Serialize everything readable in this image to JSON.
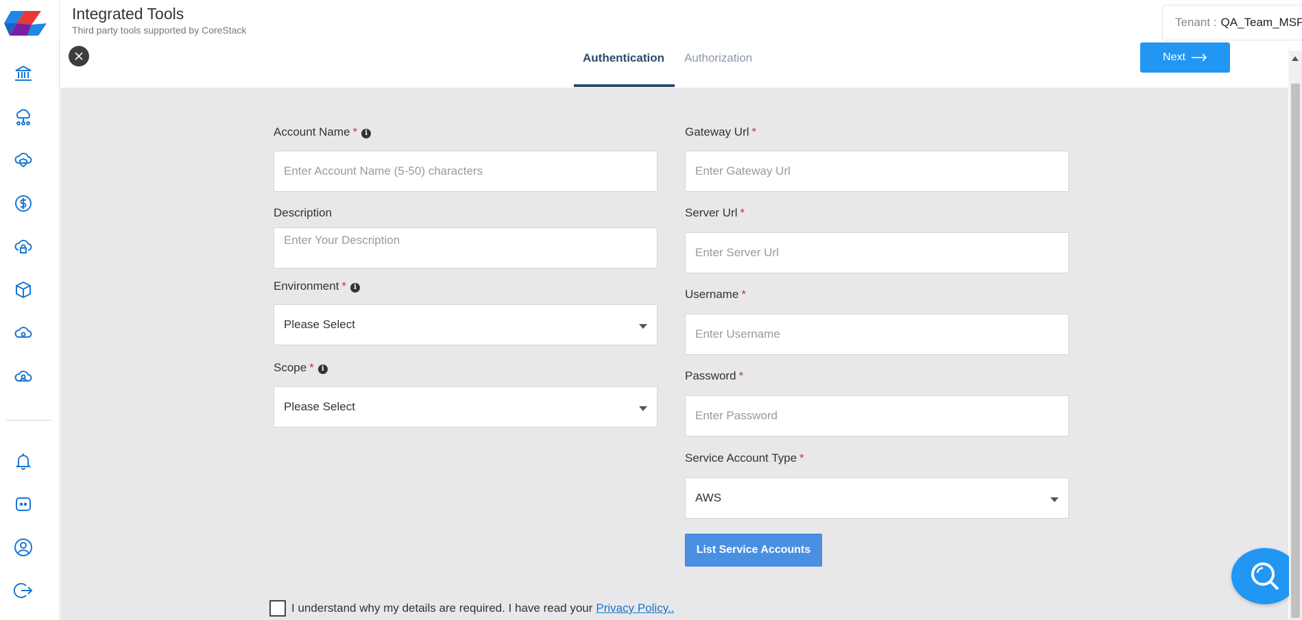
{
  "header": {
    "title": "Integrated Tools",
    "subtitle": "Third party tools supported by CoreStack",
    "tenant_label": "Tenant :",
    "tenant_value": "QA_Team_MSP"
  },
  "sidebar": {
    "items": [
      {
        "icon": "bank-icon"
      },
      {
        "icon": "cloud-network-icon"
      },
      {
        "icon": "cloud-shield-icon"
      },
      {
        "icon": "dollar-icon"
      },
      {
        "icon": "cloud-lock-icon"
      },
      {
        "icon": "cube-icon"
      },
      {
        "icon": "cloud-gear-icon"
      },
      {
        "icon": "cloud-user-icon"
      }
    ],
    "bottom_items": [
      {
        "icon": "bell-icon"
      },
      {
        "icon": "chat-icon"
      },
      {
        "icon": "user-icon"
      },
      {
        "icon": "logout-icon"
      }
    ]
  },
  "tabs": {
    "authentication": "Authentication",
    "authorization": "Authorization",
    "next_label": "Next"
  },
  "form": {
    "account_name": {
      "label": "Account Name",
      "placeholder": "Enter Account Name (5-50) characters"
    },
    "description": {
      "label": "Description",
      "placeholder": "Enter Your Description"
    },
    "environment": {
      "label": "Environment",
      "value": "Please Select"
    },
    "scope": {
      "label": "Scope",
      "value": "Please Select"
    },
    "gateway_url": {
      "label": "Gateway Url",
      "placeholder": "Enter Gateway Url"
    },
    "server_url": {
      "label": "Server Url",
      "placeholder": "Enter Server Url"
    },
    "username": {
      "label": "Username",
      "placeholder": "Enter Username"
    },
    "password": {
      "label": "Password",
      "placeholder": "Enter Password"
    },
    "service_account_type": {
      "label": "Service Account Type",
      "value": "AWS"
    },
    "list_button": "List Service Accounts",
    "required_mark": "*",
    "info_mark": "i"
  },
  "consent": {
    "text": "I understand why my details are required. I have read your",
    "link": "Privacy Policy.."
  },
  "colors": {
    "accent": "#2196f3",
    "tab_active": "#2c4a6b",
    "icon": "#1976d2"
  }
}
